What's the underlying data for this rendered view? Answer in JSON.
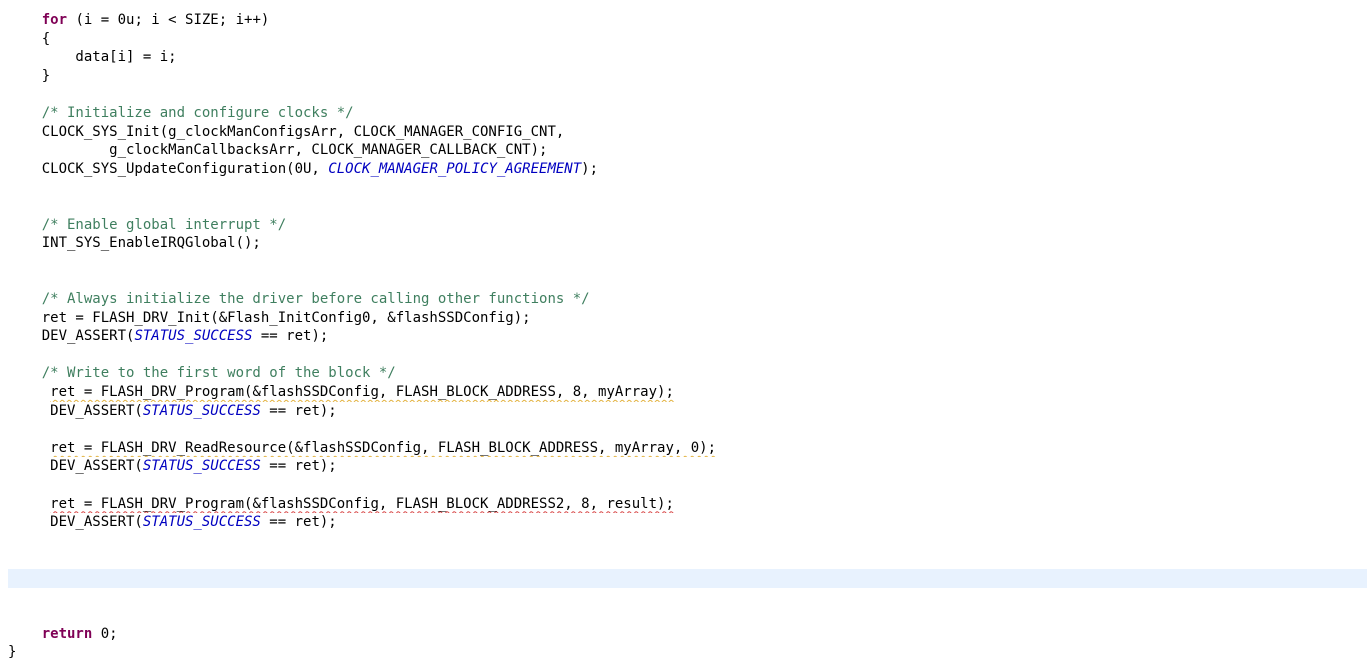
{
  "editor": {
    "current_line_index": 30,
    "lines": [
      [
        {
          "t": "kw",
          "v": "    for"
        },
        {
          "t": "tx",
          "v": " (i = 0u; i < SIZE; i++)"
        }
      ],
      [
        {
          "t": "tx",
          "v": "    {"
        }
      ],
      [
        {
          "t": "tx",
          "v": "        data[i] = i;"
        }
      ],
      [
        {
          "t": "tx",
          "v": "    }"
        }
      ],
      [],
      [
        {
          "t": "cm",
          "v": "    /* Initialize and configure clocks */"
        }
      ],
      [
        {
          "t": "tx",
          "v": "    CLOCK_SYS_Init(g_clockManConfigsArr, CLOCK_MANAGER_CONFIG_CNT,"
        }
      ],
      [
        {
          "t": "tx",
          "v": "            g_clockManCallbacksArr, CLOCK_MANAGER_CALLBACK_CNT);"
        }
      ],
      [
        {
          "t": "tx",
          "v": "    CLOCK_SYS_UpdateConfiguration(0U, "
        },
        {
          "t": "ec",
          "v": "CLOCK_MANAGER_POLICY_AGREEMENT"
        },
        {
          "t": "tx",
          "v": ");"
        }
      ],
      [],
      [],
      [
        {
          "t": "cm",
          "v": "    /* Enable global interrupt */"
        }
      ],
      [
        {
          "t": "tx",
          "v": "    INT_SYS_EnableIRQGlobal();"
        }
      ],
      [],
      [],
      [
        {
          "t": "cm",
          "v": "    /* Always initialize the driver before calling other functions */"
        }
      ],
      [
        {
          "t": "tx",
          "v": "    ret = FLASH_DRV_Init(&Flash_InitConfig0, &flashSSDConfig);"
        }
      ],
      [
        {
          "t": "tx",
          "v": "    DEV_ASSERT("
        },
        {
          "t": "ec",
          "v": "STATUS_SUCCESS"
        },
        {
          "t": "tx",
          "v": " == ret);"
        }
      ],
      [],
      [
        {
          "t": "cm",
          "v": "    /* Write to the first word of the block */"
        }
      ],
      [
        {
          "t": "tx",
          "v": "     "
        },
        {
          "t": "warn",
          "v": "ret = FLASH_DRV_Program(&flashSSDConfig, FLASH_BLOCK_ADDRESS, 8, myArray);"
        }
      ],
      [
        {
          "t": "tx",
          "v": "     DEV_ASSERT("
        },
        {
          "t": "ec",
          "v": "STATUS_SUCCESS"
        },
        {
          "t": "tx",
          "v": " == ret);"
        }
      ],
      [],
      [
        {
          "t": "tx",
          "v": "     "
        },
        {
          "t": "warn",
          "v": "ret = FLASH_DRV_ReadResource(&flashSSDConfig, FLASH_BLOCK_ADDRESS, myArray, 0);"
        }
      ],
      [
        {
          "t": "tx",
          "v": "     DEV_ASSERT("
        },
        {
          "t": "ec",
          "v": "STATUS_SUCCESS"
        },
        {
          "t": "tx",
          "v": " == ret);"
        }
      ],
      [],
      [
        {
          "t": "tx",
          "v": "     "
        },
        {
          "t": "err",
          "v": "ret = FLASH_DRV_Program(&flashSSDConfig, FLASH_BLOCK_ADDRESS2, 8, result);"
        }
      ],
      [
        {
          "t": "tx",
          "v": "     DEV_ASSERT("
        },
        {
          "t": "ec",
          "v": "STATUS_SUCCESS"
        },
        {
          "t": "tx",
          "v": " == ret);"
        }
      ],
      [],
      [],
      [],
      [],
      [],
      [
        {
          "t": "kw",
          "v": "    return"
        },
        {
          "t": "tx",
          "v": " 0;"
        }
      ],
      [
        {
          "t": "tx",
          "v": "}"
        }
      ]
    ]
  }
}
